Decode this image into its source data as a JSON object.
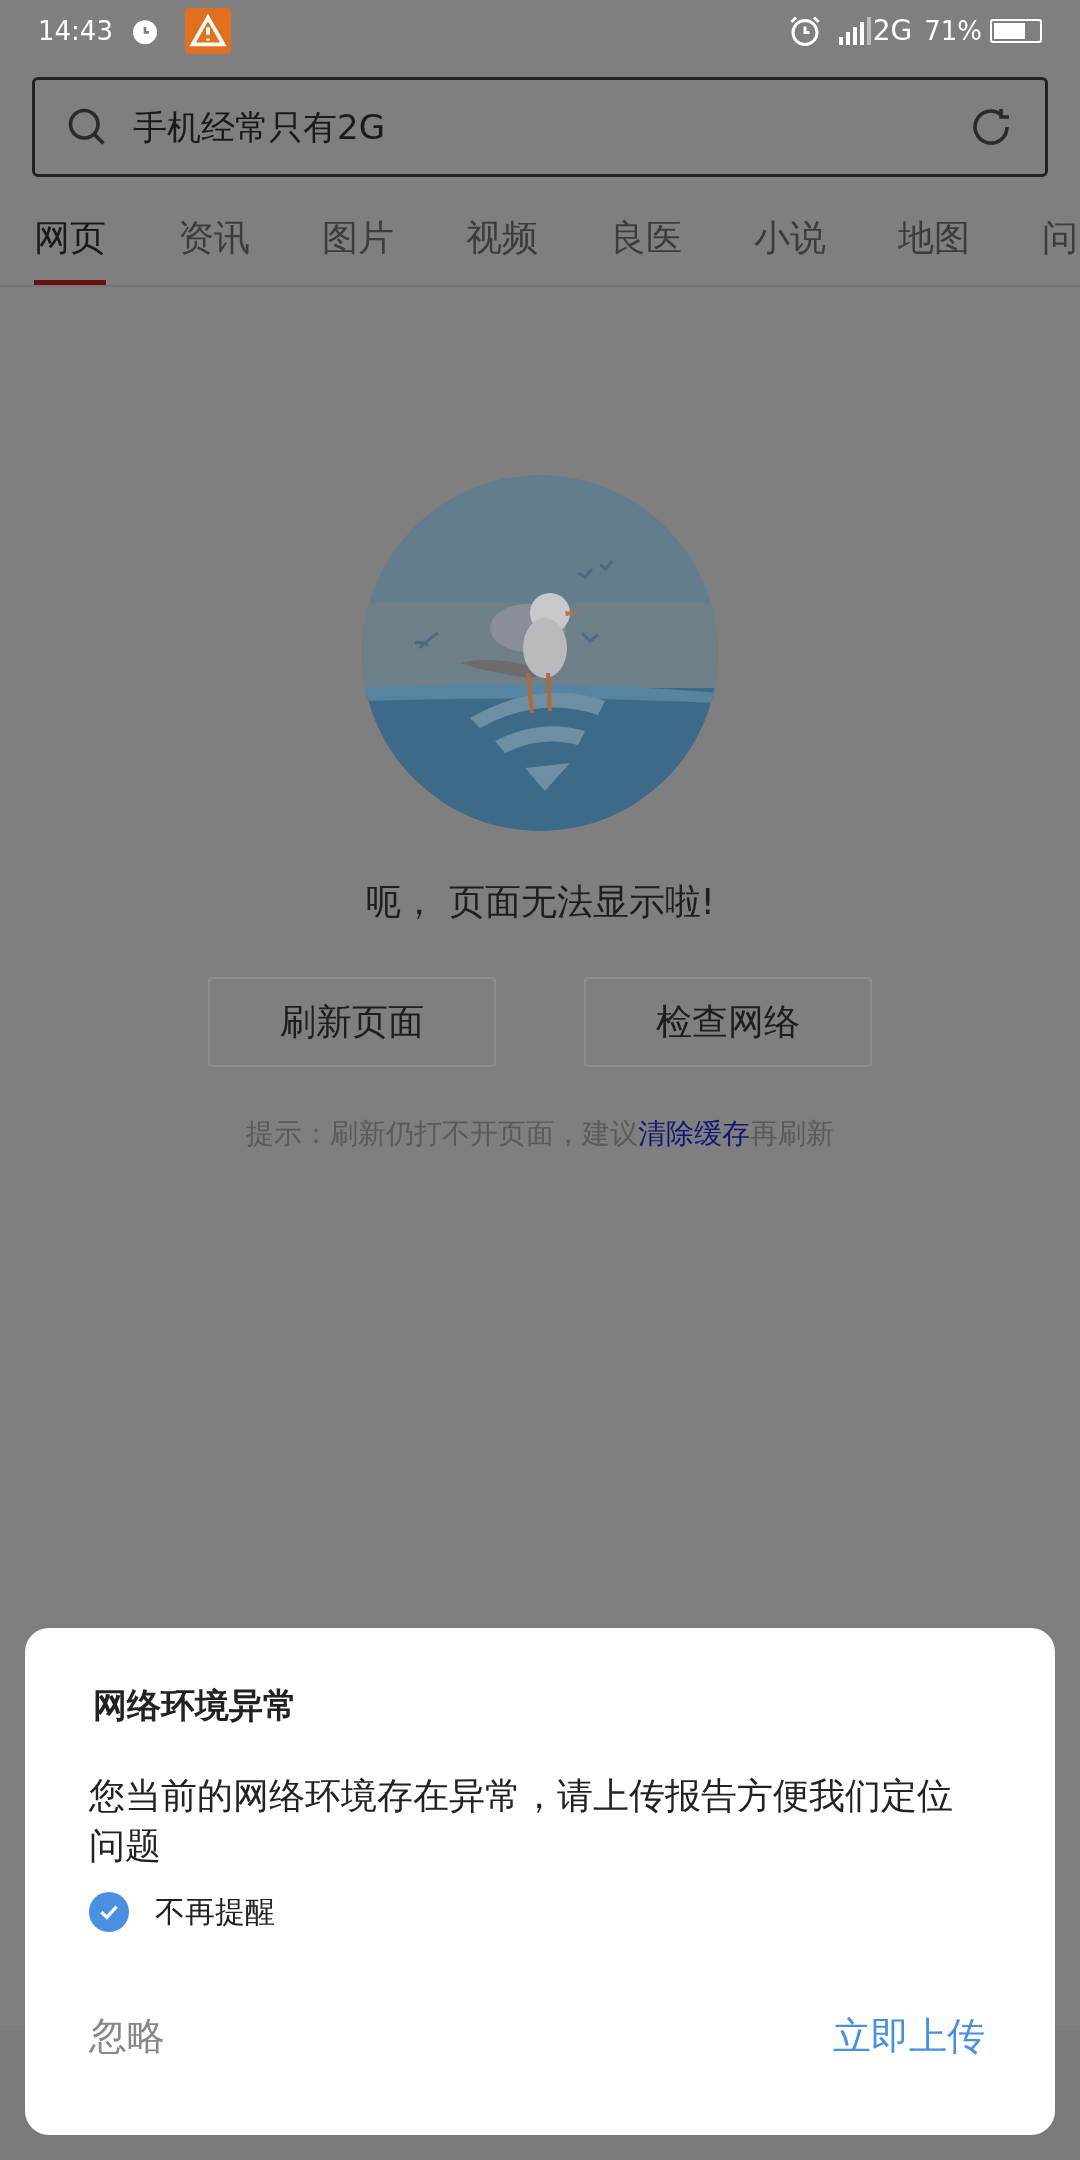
{
  "status_bar": {
    "time": "14:43",
    "network": "2G",
    "battery": "71%",
    "level": 0.71
  },
  "search": {
    "value": "手机经常只有2G"
  },
  "tabs": [
    {
      "label": "网页",
      "selected": true
    },
    {
      "label": "资讯",
      "selected": false
    },
    {
      "label": "图片",
      "selected": false
    },
    {
      "label": "视频",
      "selected": false
    },
    {
      "label": "良医",
      "selected": false
    },
    {
      "label": "小说",
      "selected": false
    },
    {
      "label": "地图",
      "selected": false
    },
    {
      "label": "问",
      "selected": false
    }
  ],
  "error": {
    "message": "呃， 页面无法显示啦!",
    "buttons": [
      "刷新页面",
      "检查网络"
    ],
    "hint_before": "提示：刷新仍打不开页面，建议",
    "hint_link": "清除缓存",
    "hint_after": "再刷新"
  },
  "dialog": {
    "title": "网络环境异常",
    "body": "您当前的网络环境存在异常，请上传报告方便我们定位问题",
    "checkbox": {
      "label": "不再提醒",
      "checked": true
    },
    "dismiss": "忽略",
    "confirm": "立即上传"
  }
}
